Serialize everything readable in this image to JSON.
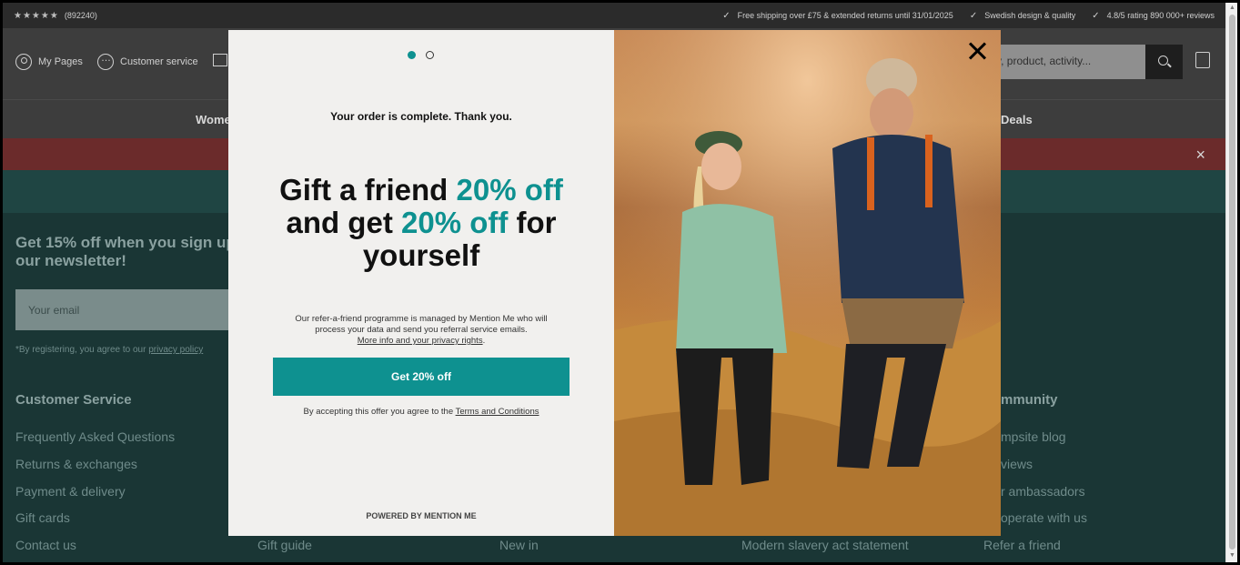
{
  "topbar": {
    "stars": "★★★★★",
    "rating_count": "(892240)",
    "usps": [
      "Free shipping over £75 & extended returns until 31/01/2025",
      "Swedish design & quality",
      "4.8/5 rating 890 000+ reviews"
    ]
  },
  "header": {
    "my_pages": "My Pages",
    "customer_service": "Customer service",
    "search_placeholder": "y, product, activity..."
  },
  "nav": {
    "left_item": "Wome",
    "right_item": "Deals"
  },
  "banner": {
    "close_icon": "×"
  },
  "footer": {
    "newsletter_title": "Get 15% off when you sign up our newsletter!",
    "email_placeholder": "Your email",
    "register_note": "*By registering, you agree to our",
    "privacy_link": "privacy policy",
    "col1_title": "Customer Service",
    "col1_links": [
      "Frequently Asked Questions",
      "Returns & exchanges",
      "Payment & delivery",
      "Gift cards",
      "Contact us"
    ],
    "col2_link": "Gift guide",
    "col3_link": "New in",
    "col4_link": "Modern slavery act statement",
    "col5_title": "mmunity",
    "col5_links": [
      "mpsite blog",
      "views",
      "r ambassadors",
      "operate with us",
      "Refer a friend"
    ]
  },
  "modal": {
    "order_complete": "Your order is complete. Thank you.",
    "headline_1": "Gift a friend ",
    "headline_teal_1": "20% off",
    "headline_2": "and get ",
    "headline_teal_2": "20% off",
    "headline_3": " for yourself",
    "fine_print": "Our refer-a-friend programme is managed by Mention Me who will process your data and send you referral service emails.",
    "more_info_link": "More info and your privacy rights",
    "cta_label": "Get 20% off",
    "accept_text": "By accepting this offer you agree to the",
    "terms_link": "Terms and Conditions",
    "powered_by": "POWERED BY MENTION ME",
    "accent_color": "#0e9190"
  }
}
